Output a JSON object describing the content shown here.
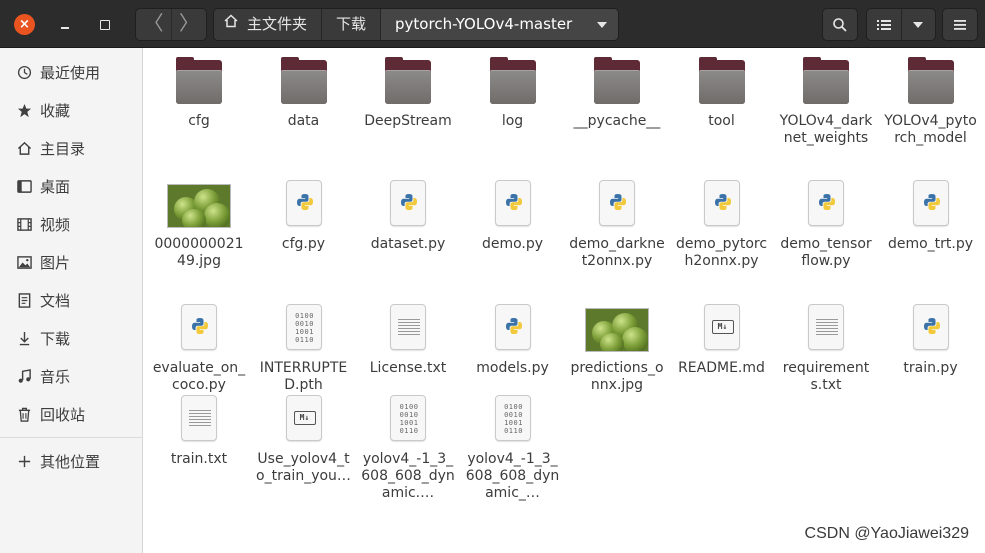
{
  "window": {
    "close_label": "×"
  },
  "nav": {
    "back_label": "〈",
    "forward_label": "〉"
  },
  "path": {
    "crumbs": [
      {
        "label": "主文件夹",
        "icon": "home-icon"
      },
      {
        "label": "下载"
      },
      {
        "label": "pytorch-YOLOv4-master",
        "active": true
      }
    ]
  },
  "toolbar": {
    "search_icon": "search-icon",
    "list_view_icon": "list-view-icon",
    "view_options_icon": "chevron-down-icon",
    "menu_icon": "hamburger-menu-icon"
  },
  "sidebar": {
    "items": [
      {
        "label": "最近使用",
        "icon": "clock-icon",
        "glyph": "🕑"
      },
      {
        "label": "收藏",
        "icon": "star-icon",
        "glyph": "★"
      },
      {
        "label": "主目录",
        "icon": "home-icon",
        "glyph": "⌂"
      },
      {
        "label": "桌面",
        "icon": "desktop-icon",
        "glyph": "▭"
      },
      {
        "label": "视频",
        "icon": "video-icon",
        "glyph": "🎞"
      },
      {
        "label": "图片",
        "icon": "picture-icon",
        "glyph": "🖼"
      },
      {
        "label": "文档",
        "icon": "document-icon",
        "glyph": "🗎"
      },
      {
        "label": "下载",
        "icon": "download-icon",
        "glyph": "⇩"
      },
      {
        "label": "音乐",
        "icon": "music-icon",
        "glyph": "♫"
      },
      {
        "label": "回收站",
        "icon": "trash-icon",
        "glyph": "🗑"
      }
    ],
    "other_locations": {
      "label": "其他位置",
      "icon": "plus-icon",
      "glyph": "+"
    }
  },
  "files": [
    {
      "name": "cfg",
      "type": "folder"
    },
    {
      "name": "data",
      "type": "folder"
    },
    {
      "name": "DeepStream",
      "type": "folder"
    },
    {
      "name": "log",
      "type": "folder"
    },
    {
      "name": "__pycache__",
      "type": "folder"
    },
    {
      "name": "tool",
      "type": "folder"
    },
    {
      "name": "YOLOv4_darknet_weights",
      "type": "folder"
    },
    {
      "name": "YOLOv4_pytorch_model",
      "type": "folder"
    },
    {
      "name": "000000002149.jpg",
      "type": "image"
    },
    {
      "name": "cfg.py",
      "type": "python"
    },
    {
      "name": "dataset.py",
      "type": "python"
    },
    {
      "name": "demo.py",
      "type": "python"
    },
    {
      "name": "demo_darknet2onnx.py",
      "type": "python"
    },
    {
      "name": "demo_pytorch2onnx.py",
      "type": "python"
    },
    {
      "name": "demo_tensorflow.py",
      "type": "python"
    },
    {
      "name": "demo_trt.py",
      "type": "python"
    },
    {
      "name": "evaluate_on_coco.py",
      "type": "python"
    },
    {
      "name": "INTERRUPTED.pth",
      "type": "binary"
    },
    {
      "name": "License.txt",
      "type": "text"
    },
    {
      "name": "models.py",
      "type": "python"
    },
    {
      "name": "predictions_onnx.jpg",
      "type": "image"
    },
    {
      "name": "README.md",
      "type": "markdown"
    },
    {
      "name": "requirements.txt",
      "type": "text"
    },
    {
      "name": "train.py",
      "type": "python"
    },
    {
      "name": "train.txt",
      "type": "text"
    },
    {
      "name": "Use_yolov4_to_train_you…",
      "type": "markdown"
    },
    {
      "name": "yolov4_-1_3_608_608_dynamic.…",
      "type": "binary"
    },
    {
      "name": "yolov4_-1_3_608_608_dynamic_…",
      "type": "binary"
    }
  ],
  "binary_glyph": "0100\n0010\n1001\n0110",
  "markdown_glyph": "M↓",
  "watermark": "CSDN @YaoJiawei329",
  "colors": {
    "accent": "#e95420",
    "folder": "#5e2a35",
    "header": "#2c2c2c"
  }
}
